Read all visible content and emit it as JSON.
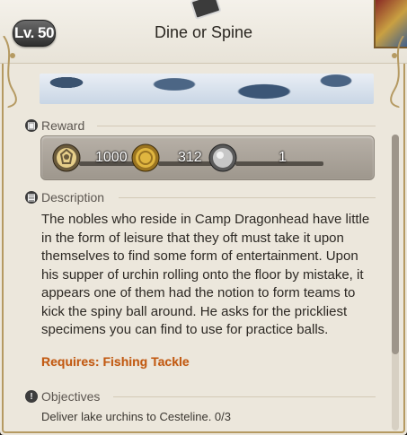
{
  "header": {
    "level": "Lv. 50",
    "title": "Dine or Spine"
  },
  "reward": {
    "heading": "Reward",
    "items": [
      {
        "icon": "experience-icon",
        "value": "1000"
      },
      {
        "icon": "gil-coin-icon",
        "value": "312"
      },
      {
        "icon": "seal-coin-icon",
        "value": "1"
      }
    ]
  },
  "description": {
    "heading": "Description",
    "text": "The nobles who reside in Camp Dragonhead have little in the form of leisure that they oft must take it upon themselves to find some form of entertainment. Upon his supper of urchin rolling onto the floor by mistake, it appears one of them had the notion to form teams to kick the spiny ball around. He asks for the prickliest specimens you can find to use for practice balls.",
    "requires": "Requires: Fishing Tackle"
  },
  "objectives": {
    "heading": "Objectives",
    "items": [
      "Deliver lake urchins to Cesteline. 0/3"
    ]
  },
  "colors": {
    "requires_text": "#c25a12",
    "panel_bg": "#ece7dc",
    "border_gold": "#b59a62"
  }
}
